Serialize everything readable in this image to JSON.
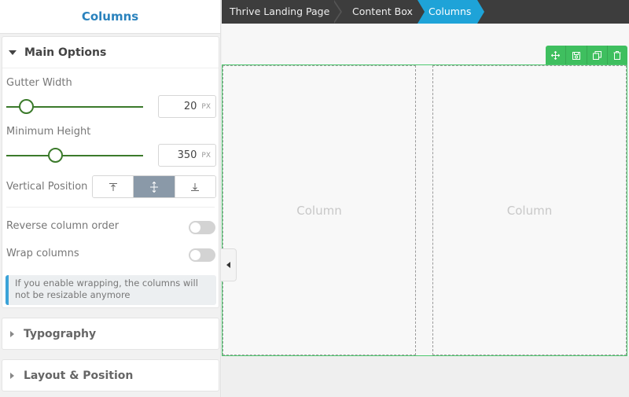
{
  "sidebar": {
    "title": "Columns",
    "main_options": {
      "label": "Main Options",
      "gutter_width": {
        "label": "Gutter Width",
        "value": "20",
        "unit": "PX"
      },
      "minimum_height": {
        "label": "Minimum Height",
        "value": "350",
        "unit": "PX"
      },
      "vertical_position": {
        "label": "Vertical Position",
        "options": [
          "top",
          "center",
          "bottom"
        ],
        "selected": "center"
      },
      "reverse_order": {
        "label": "Reverse column order",
        "enabled": false
      },
      "wrap_columns": {
        "label": "Wrap columns",
        "enabled": false
      },
      "info": "If you enable wrapping, the columns will not be resizable anymore"
    },
    "typography": {
      "label": "Typography"
    },
    "layout_position": {
      "label": "Layout & Position"
    }
  },
  "breadcrumb": {
    "items": [
      "Thrive Landing Page",
      "Content Box",
      "Columns"
    ]
  },
  "canvas": {
    "column_labels": [
      "Column",
      "Column"
    ],
    "toolbar_icons": [
      "move-icon",
      "save-icon",
      "duplicate-icon",
      "delete-icon"
    ]
  },
  "colors": {
    "accent_blue": "#1ea3d8",
    "slider_green": "#3b7a2b",
    "toolbar_green": "#3fbf5f",
    "active_segment": "#8a99a8"
  }
}
